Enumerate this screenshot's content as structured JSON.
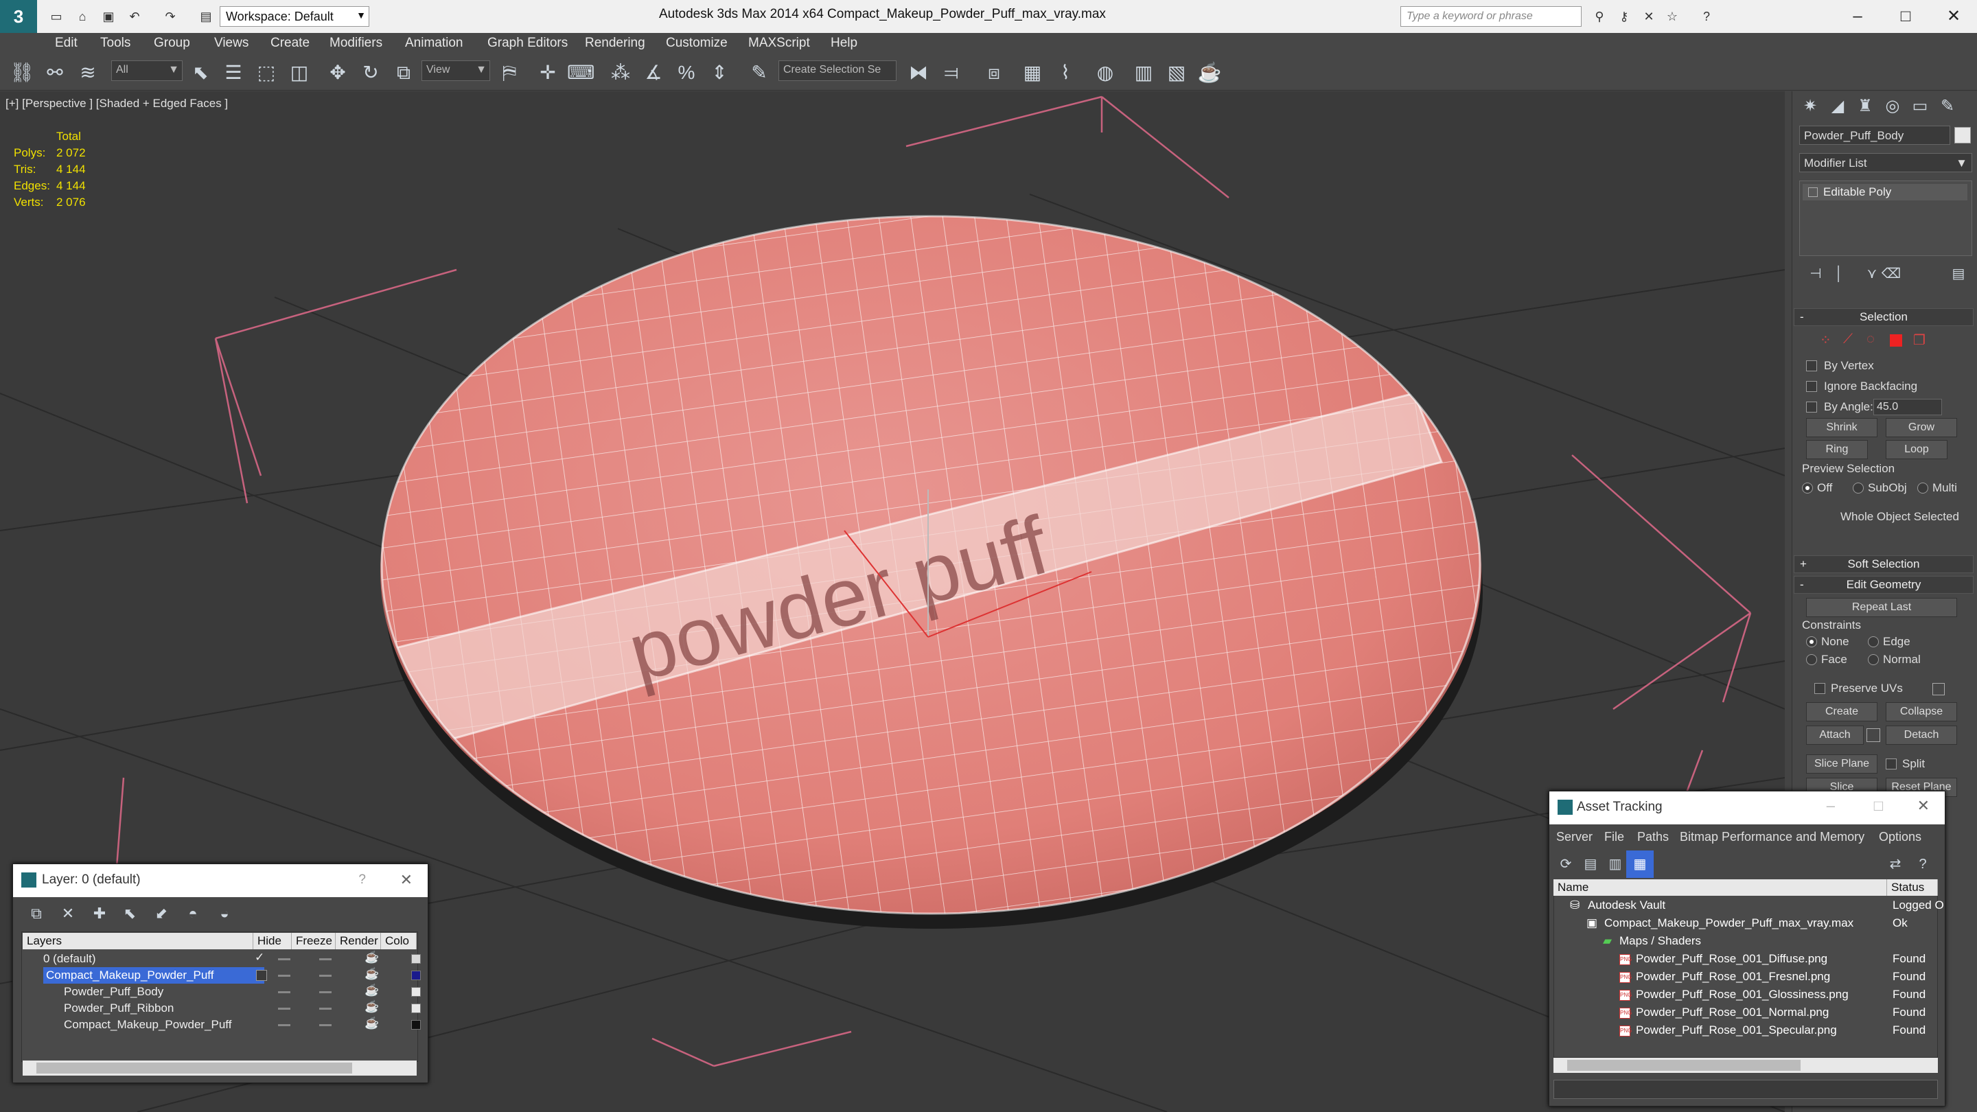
{
  "titlebar": {
    "app_title": "Autodesk 3ds Max 2014 x64      Compact_Makeup_Powder_Puff_max_vray.max",
    "workspace": "Workspace: Default",
    "search_placeholder": "Type a keyword or phrase"
  },
  "menu": [
    "Edit",
    "Tools",
    "Group",
    "Views",
    "Create",
    "Modifiers",
    "Animation",
    "Graph Editors",
    "Rendering",
    "Customize",
    "MAXScript",
    "Help"
  ],
  "toolbar": {
    "filter_value": "All",
    "refcoord_value": "View",
    "selection_set_placeholder": "Create Selection Se"
  },
  "viewport": {
    "label": "[+] [Perspective ] [Shaded + Edged Faces ]",
    "stats_header": "Total",
    "stats": [
      {
        "label": "Polys:",
        "value": "2 072"
      },
      {
        "label": "Tris:",
        "value": "4 144"
      },
      {
        "label": "Edges:",
        "value": "4 144"
      },
      {
        "label": "Verts:",
        "value": "2 076"
      }
    ],
    "object_text": "powder puff"
  },
  "command_panel": {
    "object_name": "Powder_Puff_Body",
    "modifier_list": "Modifier List",
    "stack_item": "Editable Poly",
    "selection_title": "Selection",
    "by_vertex": "By Vertex",
    "ignore_backfacing": "Ignore Backfacing",
    "by_angle": "By Angle:",
    "angle_value": "45.0",
    "shrink": "Shrink",
    "grow": "Grow",
    "ring": "Ring",
    "loop": "Loop",
    "preview_selection": "Preview Selection",
    "preview_off": "Off",
    "preview_subobj": "SubObj",
    "preview_multi": "Multi",
    "whole_object": "Whole Object Selected",
    "soft_selection": "Soft Selection",
    "edit_geometry": "Edit Geometry",
    "repeat_last": "Repeat Last",
    "constraints": "Constraints",
    "c_none": "None",
    "c_edge": "Edge",
    "c_face": "Face",
    "c_normal": "Normal",
    "preserve_uvs": "Preserve UVs",
    "create": "Create",
    "collapse": "Collapse",
    "attach": "Attach",
    "detach": "Detach",
    "slice_plane": "Slice Plane",
    "split": "Split",
    "slice": "Slice",
    "reset_plane": "Reset Plane"
  },
  "layer_window": {
    "title": "Layer: 0 (default)",
    "help": "?",
    "columns": [
      "Layers",
      "Hide",
      "Freeze",
      "Render",
      "Colo"
    ],
    "rows": [
      {
        "name": "0 (default)",
        "selected": false,
        "indent": 1,
        "color": "#d8d8d8",
        "check": "✓"
      },
      {
        "name": "Compact_Makeup_Powder_Puff",
        "selected": true,
        "indent": 1,
        "color": "#1a1a8c",
        "check": ""
      },
      {
        "name": "Powder_Puff_Body",
        "selected": false,
        "indent": 2,
        "color": "#e8e8e8",
        "check": ""
      },
      {
        "name": "Powder_Puff_Ribbon",
        "selected": false,
        "indent": 2,
        "color": "#e8e8e8",
        "check": ""
      },
      {
        "name": "Compact_Makeup_Powder_Puff",
        "selected": false,
        "indent": 2,
        "color": "#111111",
        "check": ""
      }
    ]
  },
  "asset_window": {
    "title": "Asset Tracking",
    "menu": [
      "Server",
      "File",
      "Paths",
      "Bitmap Performance and Memory",
      "Options"
    ],
    "columns": [
      "Name",
      "Status"
    ],
    "rows": [
      {
        "name": "Autodesk Vault",
        "status": "Logged O",
        "indent": 0,
        "icon": "vault"
      },
      {
        "name": "Compact_Makeup_Powder_Puff_max_vray.max",
        "status": "Ok",
        "indent": 1,
        "icon": "max"
      },
      {
        "name": "Maps / Shaders",
        "status": "",
        "indent": 2,
        "icon": "maps"
      },
      {
        "name": "Powder_Puff_Rose_001_Diffuse.png",
        "status": "Found",
        "indent": 3,
        "icon": "png"
      },
      {
        "name": "Powder_Puff_Rose_001_Fresnel.png",
        "status": "Found",
        "indent": 3,
        "icon": "png"
      },
      {
        "name": "Powder_Puff_Rose_001_Glossiness.png",
        "status": "Found",
        "indent": 3,
        "icon": "png"
      },
      {
        "name": "Powder_Puff_Rose_001_Normal.png",
        "status": "Found",
        "indent": 3,
        "icon": "png"
      },
      {
        "name": "Powder_Puff_Rose_001_Specular.png",
        "status": "Found",
        "indent": 3,
        "icon": "png"
      }
    ]
  },
  "colors": {
    "puff": "#e3857f",
    "selection_blue": "#3a6ad6",
    "stats_yellow": "#f0e000"
  }
}
